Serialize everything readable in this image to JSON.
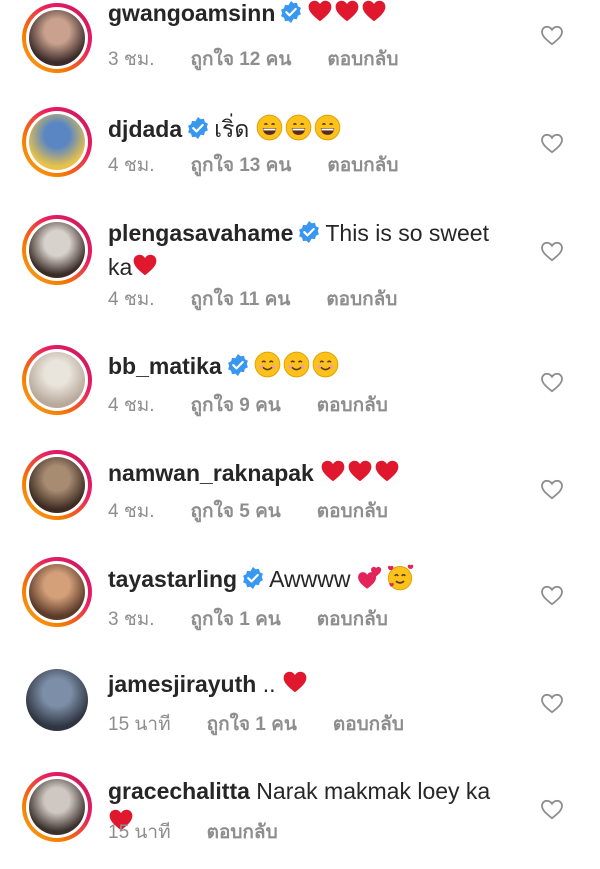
{
  "comments": [
    {
      "username": "gwangoamsinn",
      "verified": true,
      "text": "",
      "emoji": "hearts3",
      "time": "3 ชม.",
      "likes": "ถูกใจ 12 คน",
      "reply": "ตอบกลับ",
      "ring": true,
      "avatar_colors": [
        "#c9a18e",
        "#3a2a28"
      ]
    },
    {
      "username": "djdada",
      "verified": true,
      "text": "เริ่ด",
      "emoji": "grins3",
      "time": "4 ชม.",
      "likes": "ถูกใจ 13 คน",
      "reply": "ตอบกลับ",
      "ring": true,
      "avatar_colors": [
        "#5a86c4",
        "#e8c24a"
      ]
    },
    {
      "username": "plengasavahame",
      "verified": true,
      "text": "This is so sweet",
      "text_line2": "ka",
      "emoji": "heart1",
      "time": "4 ชม.",
      "likes": "ถูกใจ 11 คน",
      "reply": "ตอบกลับ",
      "ring": true,
      "avatar_colors": [
        "#d8d2cc",
        "#3b2c26"
      ]
    },
    {
      "username": "bb_matika",
      "verified": true,
      "text": "",
      "emoji": "smiles3",
      "time": "4 ชม.",
      "likes": "ถูกใจ 9 คน",
      "reply": "ตอบกลับ",
      "ring": true,
      "avatar_colors": [
        "#e9e4dc",
        "#b8a99a"
      ]
    },
    {
      "username": "namwan_raknapak",
      "verified": false,
      "text": "",
      "emoji": "hearts3",
      "time": "4 ชม.",
      "likes": "ถูกใจ 5 คน",
      "reply": "ตอบกลับ",
      "ring": true,
      "avatar_colors": [
        "#a88c72",
        "#3d2b22"
      ]
    },
    {
      "username": "tayastarling",
      "verified": true,
      "text": "Awwww",
      "emoji": "love2",
      "time": "3 ชม.",
      "likes": "ถูกใจ 1 คน",
      "reply": "ตอบกลับ",
      "ring": true,
      "avatar_colors": [
        "#d4a07a",
        "#5a3a28"
      ]
    },
    {
      "username": "jamesjirayuth",
      "verified": false,
      "text": "..",
      "emoji": "heart1",
      "time": "15 นาที",
      "likes": "ถูกใจ 1 คน",
      "reply": "ตอบกลับ",
      "ring": false,
      "avatar_colors": [
        "#7d8fa8",
        "#2e3440"
      ]
    },
    {
      "username": "gracechalitta",
      "verified": false,
      "text": "Narak makmak loey ka",
      "emoji": "heart1",
      "time": "15 นาที",
      "likes": "",
      "reply": "ตอบกลับ",
      "ring": true,
      "avatar_colors": [
        "#cfc8c2",
        "#3a302c"
      ]
    }
  ],
  "icons": {
    "verified": "verified-badge-icon",
    "like": "heart-outline-icon"
  },
  "colors": {
    "verified": "#3897f0",
    "heart": "#e0182d",
    "meta": "#8e8e8e",
    "emoji_face": "#fcc21b"
  }
}
